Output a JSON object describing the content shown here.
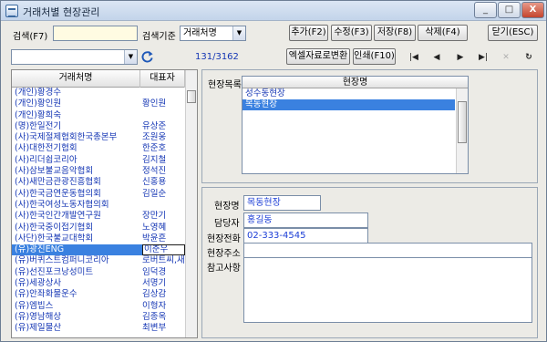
{
  "window": {
    "title": "거래처별 현장관리"
  },
  "titlebar": {
    "minimize": "_",
    "maximize": "□",
    "close": "X"
  },
  "toolbar": {
    "search_label": "검색(F7)",
    "search_value": "",
    "criteria_label": "검색기준",
    "criteria_value": "거래처명",
    "add": "추가(F2)",
    "edit": "수정(F3)",
    "save": "저장(F8)",
    "delete": "삭제(F4)",
    "close": "닫기(ESC)"
  },
  "toolbar2": {
    "filter_value": "",
    "refresh_icon": "refresh-icon",
    "record_count": "131/3162",
    "excel": "엑셀자료로변환",
    "print": "인쇄(F10)",
    "nav_first": "|◀",
    "nav_prev": "◀",
    "nav_next": "▶",
    "nav_last": "▶|",
    "nav_cancel": "✕",
    "nav_reload": "↻"
  },
  "grid": {
    "headers": [
      "거래처명",
      "대표자"
    ],
    "rows": [
      [
        "(개인)황경수",
        ""
      ],
      [
        "(개인)황인원",
        "황인원"
      ],
      [
        "(개인)황희숙",
        ""
      ],
      [
        "(명)한일전기",
        "유상준"
      ],
      [
        "(사)국제절제협회한국총본부",
        "조원웅"
      ],
      [
        "(사)대한전기협회",
        "한준호"
      ],
      [
        "(사)리더쉽코리아",
        "김지철"
      ],
      [
        "(사)삼보불교음악협회",
        "정석진"
      ],
      [
        "(사)새만금관광진흥협회",
        "신홍용"
      ],
      [
        "(사)한국금연운동협의회",
        "김일순"
      ],
      [
        "(사)한국여성노동자협의회",
        ""
      ],
      [
        "(사)한국인간개발연구원",
        "장만기"
      ],
      [
        "(사)한국중이접기협회",
        "노영혜"
      ],
      [
        "(사단)한국불교대학회",
        "박윤흔"
      ],
      [
        "(유)광진ENG",
        "이춘우"
      ],
      [
        "(유)버퀴스트컴퍼니코리아",
        "로버트씨,새비"
      ],
      [
        "(유)선진포크낭성미트",
        "임덕경"
      ],
      [
        "(유)세광상사",
        "서명기"
      ],
      [
        "(유)안좌화물운수",
        "김상감"
      ],
      [
        "(유)엠빕스",
        "이형자"
      ],
      [
        "(유)영남해상",
        "김종옥"
      ],
      [
        "(유)제일물산",
        "최변부"
      ]
    ],
    "selected_index": 14
  },
  "detail": {
    "site_list_label": "현장목록",
    "site_list_header": "현장명",
    "sites": [
      "성수동현장",
      "목동현장"
    ],
    "selected_site": 1,
    "site_name_label": "현장명",
    "site_name_value": "목동현장",
    "manager_label": "담당자",
    "manager_value": "홍길동",
    "phone_label": "현장전화",
    "phone_value": "02-333-4545",
    "address_label": "현장주소",
    "address_value": "",
    "notes_label": "참고사항",
    "notes_value": ""
  }
}
